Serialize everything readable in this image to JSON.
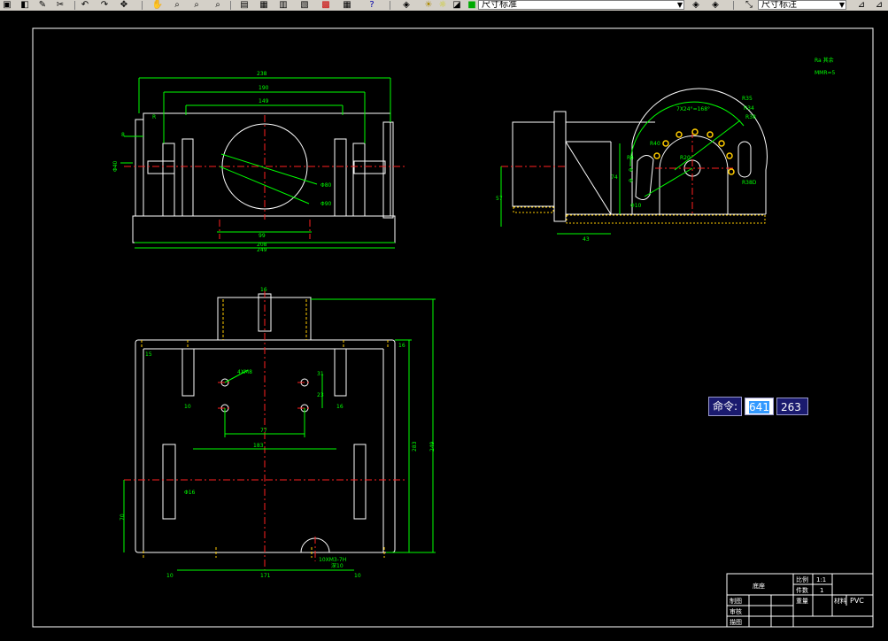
{
  "toolbar": {
    "layer_combo": "尺寸标准",
    "style_combo": "尺寸标注",
    "icons": [
      "open-icon",
      "save-icon",
      "print-icon",
      "cut-icon",
      "copy-icon",
      "paste-icon",
      "undo-icon",
      "redo-icon",
      "pan-icon",
      "zoom-icon",
      "zoom-window-icon",
      "zoom-previous-icon",
      "properties-icon",
      "design-center-icon",
      "tool-palette-icon",
      "calculator-icon",
      "help-icon",
      "layer-icon",
      "layer-state-icon"
    ]
  },
  "drawing": {
    "top_view": {
      "dims": [
        "238",
        "190",
        "149",
        "Φ80",
        "Φ90",
        "99",
        "208",
        "249",
        "8",
        "Φ40",
        "R"
      ]
    },
    "side_view": {
      "dims": [
        "7X24°=168°",
        "R35",
        "R34",
        "R38",
        "R40",
        "R4",
        "R20",
        "R38D",
        "Φ10",
        "74",
        "57",
        "43",
        "Φ",
        "Φ"
      ]
    },
    "front_view": {
      "dims": [
        "16",
        "4XM8",
        "31",
        "23",
        "16",
        "10",
        "77",
        "183",
        "10",
        "283",
        "249",
        "16",
        "15",
        "Φ16",
        "70",
        "171",
        "10",
        "10XM3-7H",
        "深10"
      ]
    },
    "roughness_note": "Ra 其余",
    "roughness_note2": "MMR=5"
  },
  "command": {
    "label": "命令:",
    "x_value": "641",
    "y_value": "263"
  },
  "title_block": {
    "name": "底座",
    "scale_label": "比例",
    "scale": "1:1",
    "qty_label": "件数",
    "qty": "1",
    "weight_label": "重量",
    "material_label": "材料",
    "material": "PVC",
    "designer_label": "制图",
    "checker_label": "审核",
    "drawer_label": "描图"
  }
}
